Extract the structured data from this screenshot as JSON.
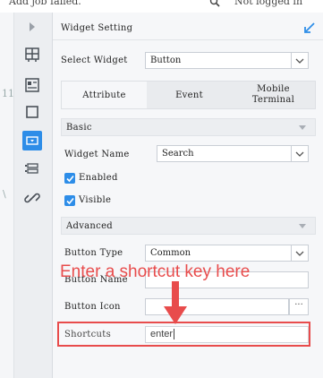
{
  "top_strip": {
    "left_text": "Add job failed.",
    "right_text": "Not logged in"
  },
  "left_edge": {
    "fragment_1": "11",
    "fragment_2": "\\"
  },
  "icon_bar": [
    {
      "name": "layout-icon"
    },
    {
      "name": "template-icon"
    },
    {
      "name": "frame-icon"
    },
    {
      "name": "widget-icon",
      "active": true
    },
    {
      "name": "list-icon"
    },
    {
      "name": "link-icon"
    }
  ],
  "panel": {
    "title": "Widget Setting",
    "select_widget": {
      "label": "Select Widget",
      "value": "Button"
    },
    "tabs": [
      {
        "label": "Attribute",
        "active": true
      },
      {
        "label": "Event"
      },
      {
        "label": "Mobile Terminal"
      }
    ],
    "basic": {
      "title": "Basic",
      "widget_name": {
        "label": "Widget Name",
        "value": "Search"
      },
      "enabled": {
        "label": "Enabled",
        "checked": true
      },
      "visible": {
        "label": "Visible",
        "checked": true
      }
    },
    "advanced": {
      "title": "Advanced",
      "button_type": {
        "label": "Button Type",
        "value": "Common"
      },
      "button_name": {
        "label": "Button Name",
        "value": ""
      },
      "button_icon": {
        "label": "Button Icon",
        "value": "",
        "more": "···"
      },
      "shortcuts": {
        "label": "Shortcuts",
        "value": "enter"
      }
    }
  },
  "annotation": {
    "text": "Enter a shortcut key here",
    "color": "#e84c4c"
  },
  "colors": {
    "accent": "#2d8de8",
    "highlight": "#e84c4c"
  }
}
